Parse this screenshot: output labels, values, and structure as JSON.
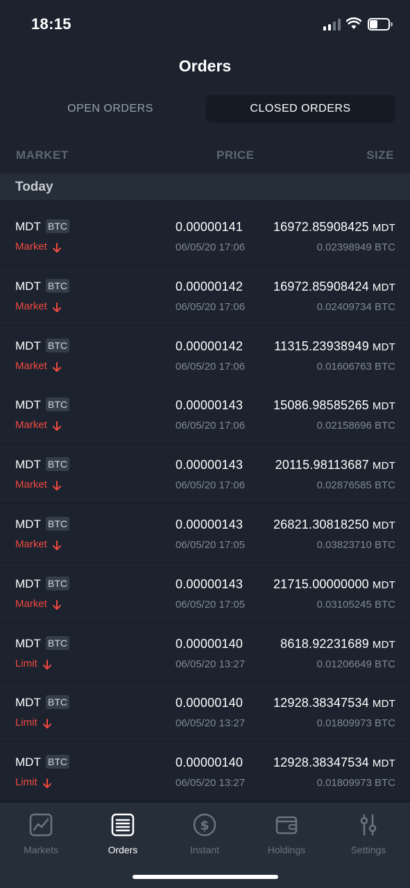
{
  "status_bar": {
    "time": "18:15"
  },
  "header": {
    "title": "Orders"
  },
  "tabs": [
    {
      "label": "OPEN ORDERS",
      "active": false
    },
    {
      "label": "CLOSED ORDERS",
      "active": true
    }
  ],
  "columns": {
    "market": "MARKET",
    "price": "PRICE",
    "size": "SIZE"
  },
  "section": {
    "title": "Today"
  },
  "orders": [
    {
      "market": "MDT",
      "quote": "BTC",
      "type": "Market",
      "price": "0.00000141",
      "date": "06/05/20 17:06",
      "size": "16972.85908425",
      "size_unit": "MDT",
      "total": "0.02398949 BTC"
    },
    {
      "market": "MDT",
      "quote": "BTC",
      "type": "Market",
      "price": "0.00000142",
      "date": "06/05/20 17:06",
      "size": "16972.85908424",
      "size_unit": "MDT",
      "total": "0.02409734 BTC"
    },
    {
      "market": "MDT",
      "quote": "BTC",
      "type": "Market",
      "price": "0.00000142",
      "date": "06/05/20 17:06",
      "size": "11315.23938949",
      "size_unit": "MDT",
      "total": "0.01606763 BTC"
    },
    {
      "market": "MDT",
      "quote": "BTC",
      "type": "Market",
      "price": "0.00000143",
      "date": "06/05/20 17:06",
      "size": "15086.98585265",
      "size_unit": "MDT",
      "total": "0.02158696 BTC"
    },
    {
      "market": "MDT",
      "quote": "BTC",
      "type": "Market",
      "price": "0.00000143",
      "date": "06/05/20 17:06",
      "size": "20115.98113687",
      "size_unit": "MDT",
      "total": "0.02876585 BTC"
    },
    {
      "market": "MDT",
      "quote": "BTC",
      "type": "Market",
      "price": "0.00000143",
      "date": "06/05/20 17:05",
      "size": "26821.30818250",
      "size_unit": "MDT",
      "total": "0.03823710 BTC"
    },
    {
      "market": "MDT",
      "quote": "BTC",
      "type": "Market",
      "price": "0.00000143",
      "date": "06/05/20 17:05",
      "size": "21715.00000000",
      "size_unit": "MDT",
      "total": "0.03105245 BTC"
    },
    {
      "market": "MDT",
      "quote": "BTC",
      "type": "Limit",
      "price": "0.00000140",
      "date": "06/05/20 13:27",
      "size": "8618.92231689",
      "size_unit": "MDT",
      "total": "0.01206649 BTC"
    },
    {
      "market": "MDT",
      "quote": "BTC",
      "type": "Limit",
      "price": "0.00000140",
      "date": "06/05/20 13:27",
      "size": "12928.38347534",
      "size_unit": "MDT",
      "total": "0.01809973 BTC"
    },
    {
      "market": "MDT",
      "quote": "BTC",
      "type": "Limit",
      "price": "0.00000140",
      "date": "06/05/20 13:27",
      "size": "12928.38347534",
      "size_unit": "MDT",
      "total": "0.01809973 BTC"
    }
  ],
  "nav": [
    {
      "label": "Markets",
      "icon": "chart-icon",
      "active": false
    },
    {
      "label": "Orders",
      "icon": "list-icon",
      "active": true
    },
    {
      "label": "Instant",
      "icon": "dollar-icon",
      "active": false
    },
    {
      "label": "Holdings",
      "icon": "wallet-icon",
      "active": false
    },
    {
      "label": "Settings",
      "icon": "sliders-icon",
      "active": false
    }
  ],
  "colors": {
    "background": "#1c232f",
    "sell": "#f2483f",
    "nav_bg": "#262e3a"
  }
}
